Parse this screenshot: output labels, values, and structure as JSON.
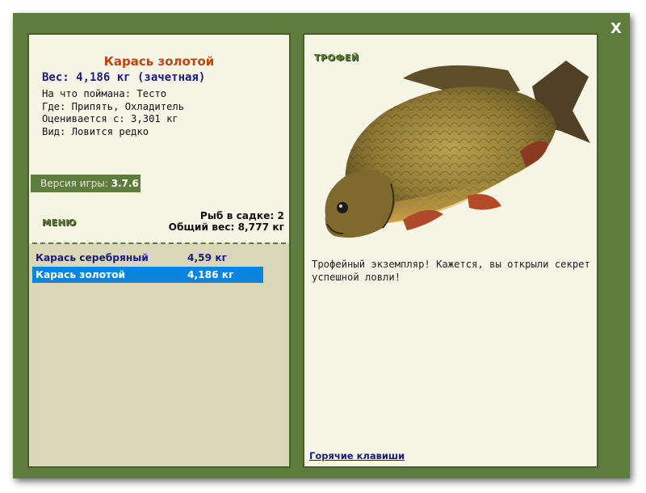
{
  "window": {
    "close_label": "X"
  },
  "catch": {
    "fish_name": "Карась золотой",
    "weight_line": "Вес: 4,186 кг (зачетная)",
    "info": [
      "На что поймана: Тесто",
      "Где: Припять, Охладитель",
      "Оценивается с: 3,301 кг",
      "Вид: Ловится редко"
    ]
  },
  "version": {
    "label": "Версия игры: ",
    "value": "3.7.6"
  },
  "menu": {
    "label": "МЕНЮ"
  },
  "cage": {
    "count_line": "Рыб в садке: 2",
    "total_line": "Общий вес: 8,777 кг"
  },
  "fish_list": [
    {
      "name": "Карась серебряный",
      "weight": "4,59 кг",
      "selected": false
    },
    {
      "name": "Карась золотой",
      "weight": "4,186 кг",
      "selected": true
    }
  ],
  "trophy": {
    "badge": "ТРОФЕЙ",
    "description": "Трофейный экземпляр! Кажется, вы открыли секрет успешной ловли!",
    "image_icon": "crucian-carp-image"
  },
  "hotkeys": {
    "label": "Горячие клавиши"
  },
  "colors": {
    "frame": "#5e7d3c",
    "title": "#c4420c",
    "selected_row": "#0a84dd",
    "link": "#1a1a86"
  }
}
